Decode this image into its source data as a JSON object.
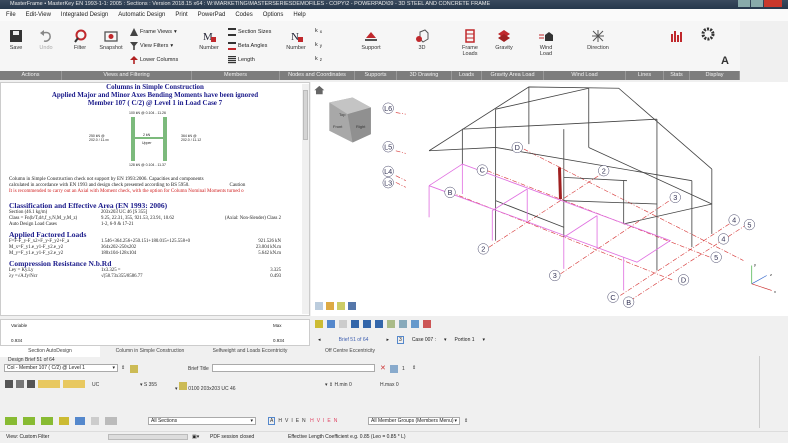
{
  "window": {
    "title": "MasterFrame • MasterKey EN 1993-1-1: 2005 : Sections : Version 2018.15 x64 : W:\\MARKETING\\MASTERSERIESDEMOFILES - COPY\\2 - POWERPAD\\09 - 3D STEEL AND CONCRETE FRAME"
  },
  "menu": [
    "File",
    "Edit-View",
    "Integrated Design",
    "Automatic Design",
    "Print",
    "PowerPad",
    "Codes",
    "Options",
    "Help"
  ],
  "ribbon": {
    "save": "Save",
    "undo": "Undo",
    "filter": "Filter",
    "snapshot": "Snapshot",
    "frame_views": "Frame Views",
    "view_filters": "View Filters",
    "lower_columns": "Lower Columns",
    "number": "Number",
    "section_sizes": "Section Sizes",
    "beta_angles": "Beta Angles",
    "length": "Length",
    "node_number": "Number",
    "kx": "x",
    "ky": "y",
    "kz": "z",
    "support": "Support",
    "d3": "3D",
    "frame_loads": "Frame Loads",
    "gravity": "Gravity",
    "wind_load": "Wind Load",
    "direction": "Direction"
  },
  "groups": [
    "Actions",
    "Views and Filtering",
    "Members",
    "Nodes and Coordinates",
    "Supports",
    "3D Drawing",
    "Loads",
    "Gravity Area Load",
    "Wind Load",
    "Lines",
    "Stats",
    "Display"
  ],
  "report": {
    "h1": "Columns in Simple Construction",
    "h2": "Applied Major and Minor Axes Bending Moments have been ignored",
    "h3": "Member 107 ( C/2) @ Level 1 in Load Case  7",
    "diag_top": "100 kN @ 0.104 - 11.26",
    "diag_left": "250 kN @ 202.0 / 11.xx",
    "diag_right": "364 kN @ 202.0 / 11.12",
    "diag_center": "2 kN",
    "diag_center2": "Upper",
    "diag_bottom": "128 kN @ 0.104 - 11.37",
    "p1": "Column in Simple Construction check not support by EN 1993:2006. Capacities and components",
    "p2": "calculated in accordance with EN 1993 and design check presented according to BS 5950.",
    "caution": "Caution",
    "warn": "It is recommended to carry out an Axial with Moment check, with the option for Column Nominal Moments turned o",
    "s1": "Classification and Effective Area (EN 1993: 2006)",
    "s1rows": [
      [
        "Section (46.1 kg/m)",
        "203x203 UC 46 [S 355]",
        ""
      ],
      [
        "Class = Fn(b/T,d/t,f_y,N,M_y,M_z)",
        "9.25, 22.31, 355, 921.53, 23.91, 10.62",
        "(Axial: Non-Slender)  Class 2"
      ],
      [
        "Auto Design Load Cases",
        "1-2, 6-9 & 17-21",
        ""
      ]
    ],
    "s2": "Applied Factored Loads",
    "s2rows": [
      [
        "F=F-F_y-F_x2+F_y-F_y2+F_a",
        "1.546+364.256+250.151+180.015+125.558+0",
        "921.526 kN"
      ],
      [
        "M_x=F_y1.e_y1-F_y2.e_y2",
        "364x202-250x202",
        "23.004 kN.m"
      ],
      [
        "M_y=F_y1.e_y1-F_y2.e_y2",
        "180x104-128x104",
        "5.642 kN.m"
      ]
    ],
    "s3": "Compression Resistance N.b.Rd",
    "s3rows": [
      [
        "Ley = Ky.Ly",
        "1x3.325 =",
        "3.325"
      ],
      [
        "λy =√A.fy/Ncr",
        "√(58.73x355/8586.77",
        "0.493"
      ]
    ]
  },
  "view": {
    "cube_top": "Top",
    "cube_front": "Front",
    "cube_right": "Right",
    "levels": [
      "L6",
      "L5",
      "L4",
      "L3"
    ],
    "grid": [
      "D",
      "C",
      "B",
      "2",
      "2",
      "3",
      "3",
      "4",
      "5",
      "4",
      "5",
      "D",
      "C",
      "B"
    ],
    "axes": [
      "y",
      "z",
      "x"
    ]
  },
  "results": {
    "col1": "Variable",
    "col2": "Max",
    "v1": "0.934",
    "v2": "0.934"
  },
  "brief_nav": "Brief 51 of 64",
  "case": "Case 007 :",
  "portion": "Portion 1",
  "case_num": "3",
  "tabs": [
    "Section AutoDesign",
    "Column in Simple Construction",
    "Selfweight and Loads Eccentricity",
    "Off Centre Eccentricity"
  ],
  "design": {
    "brief_label": "Design Brief 51 of 64",
    "member": "Col - Member 107 ( C/2) @ Level 1",
    "brief_title_label": "Brief Title",
    "brief_title": "",
    "count": "1",
    "type": "UC",
    "grade": "S 355",
    "section": "0100 203x203 UC 46",
    "hmin_label": "H.min",
    "hmin": "0",
    "hmax_label": "H.max",
    "hmax": "0",
    "all_sections": "All Sections",
    "letters": [
      "A",
      "H",
      "V",
      "I",
      "E",
      "N"
    ],
    "letters_red": [
      "H",
      "V",
      "I",
      "E",
      "N"
    ],
    "groups": "All Member Groups (Members Menu)"
  },
  "status": {
    "filter": "View: Custom Filter",
    "pdf": "PDF session closed",
    "hint": "Effective Length Coefficient e.g. 0.85 (Leo = 0.85 * L)"
  },
  "colors": {
    "accent": "#c0282c",
    "ribbon_group": "#7d7d7d",
    "report_heading": "#1a1a8a"
  }
}
